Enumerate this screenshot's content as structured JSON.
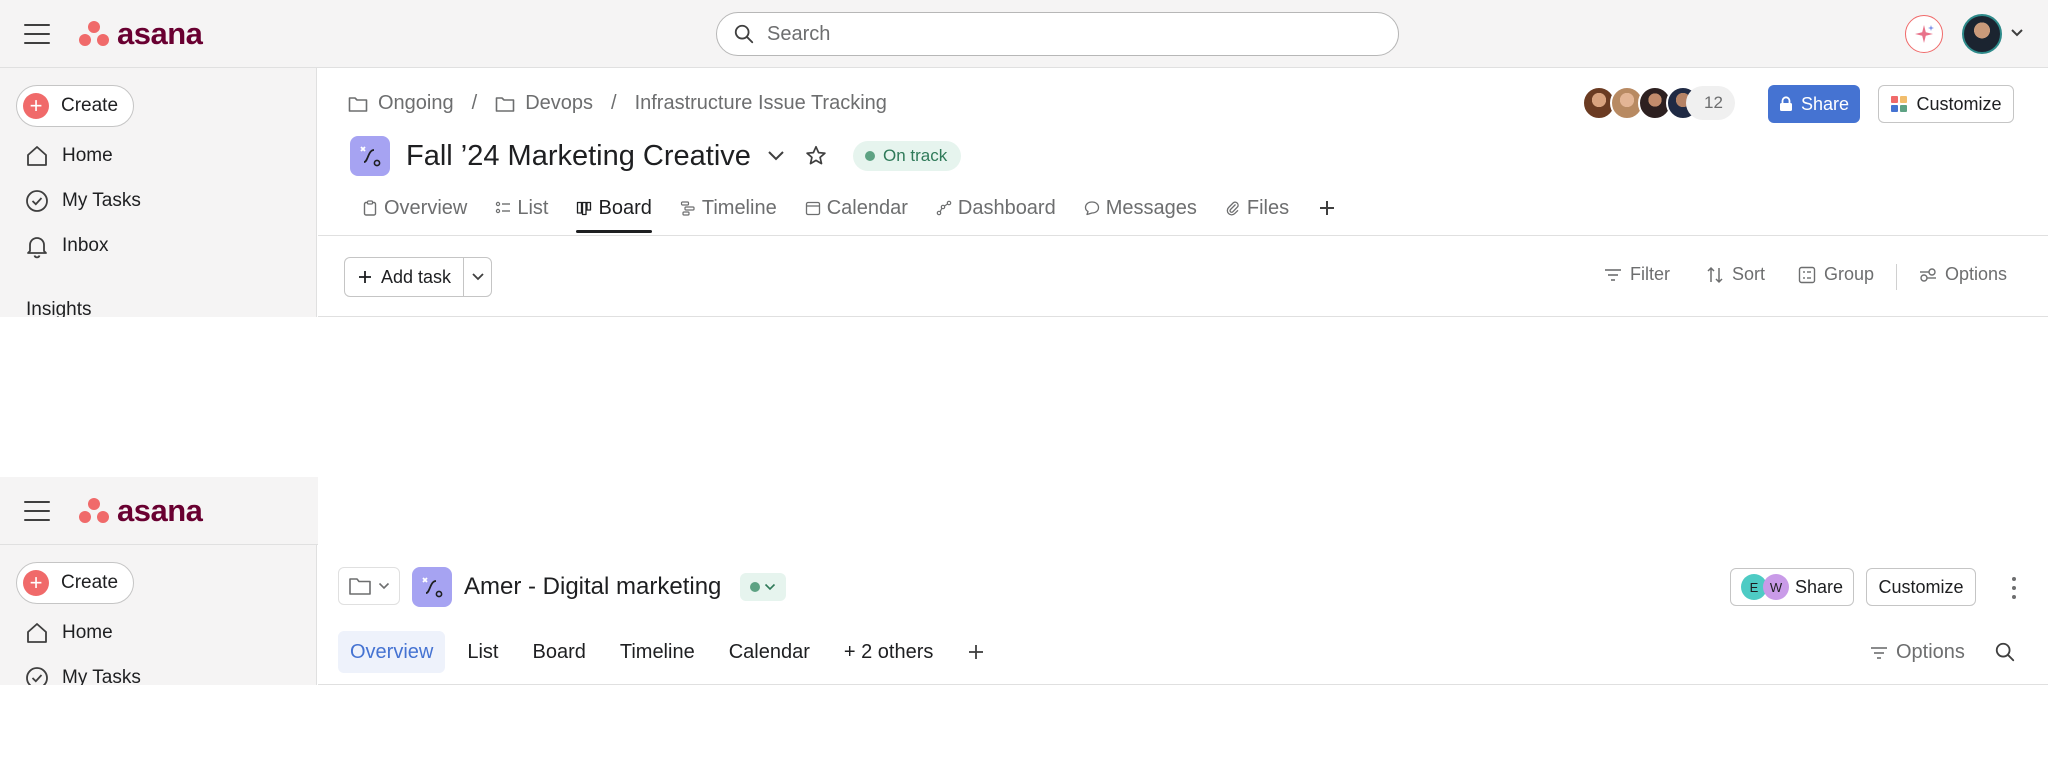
{
  "app": {
    "logo_text": "asana",
    "brand_color": "#f06a6a",
    "logo_text_color": "#690031"
  },
  "panel1": {
    "topbar": {
      "search_placeholder": "Search"
    },
    "sidebar": {
      "create_label": "Create",
      "items": [
        {
          "label": "Home",
          "icon": "home-icon"
        },
        {
          "label": "My Tasks",
          "icon": "check-circle-icon"
        },
        {
          "label": "Inbox",
          "icon": "bell-icon"
        }
      ],
      "section": "Insights"
    },
    "breadcrumb": [
      "Ongoing",
      "Devops",
      "Infrastructure Issue Tracking"
    ],
    "members_count": "12",
    "share_label": "Share",
    "customize_label": "Customize",
    "project": {
      "title": "Fall ’24 Marketing Creative",
      "status": "On track",
      "status_color": "#5da283"
    },
    "tabs": [
      {
        "label": "Overview",
        "icon": "clipboard-icon"
      },
      {
        "label": "List",
        "icon": "list-icon"
      },
      {
        "label": "Board",
        "icon": "board-icon",
        "active": true
      },
      {
        "label": "Timeline",
        "icon": "timeline-icon"
      },
      {
        "label": "Calendar",
        "icon": "calendar-icon"
      },
      {
        "label": "Dashboard",
        "icon": "dashboard-icon"
      },
      {
        "label": "Messages",
        "icon": "chat-icon"
      },
      {
        "label": "Files",
        "icon": "paperclip-icon"
      }
    ],
    "toolbar": {
      "add_task": "Add task",
      "filter": "Filter",
      "sort": "Sort",
      "group": "Group",
      "options": "Options"
    }
  },
  "panel2": {
    "topbar": {
      "search_placeholder": "Search"
    },
    "sidebar": {
      "create_label": "Create",
      "items": [
        {
          "label": "Home",
          "icon": "home-icon"
        },
        {
          "label": "My Tasks",
          "icon": "check-circle-icon"
        }
      ]
    },
    "project": {
      "title": "Amer - Digital marketing"
    },
    "share": {
      "label": "Share",
      "avatars": [
        "E",
        "W"
      ]
    },
    "customize_label": "Customize",
    "tabs": [
      {
        "label": "Overview",
        "active": true
      },
      {
        "label": "List"
      },
      {
        "label": "Board"
      },
      {
        "label": "Timeline"
      },
      {
        "label": "Calendar"
      },
      {
        "label": "+ 2 others"
      }
    ],
    "options_label": "Options"
  }
}
